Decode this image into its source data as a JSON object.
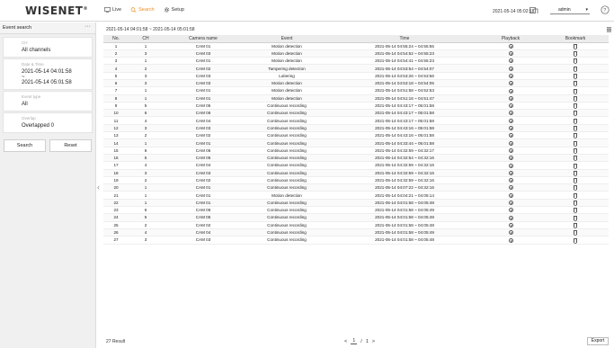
{
  "app": {
    "logo": "WISENET",
    "logo_mark": "®",
    "nav": [
      {
        "label": "Live"
      },
      {
        "label": "Search"
      },
      {
        "label": "Setup"
      }
    ],
    "datetime": "2021-05-14 05:02:18",
    "user": "admin"
  },
  "sidebar": {
    "title": "Event search",
    "more": "···",
    "channel": {
      "label": "CH",
      "value": "All channels"
    },
    "datetime": {
      "label": "Date & Time",
      "value_line1": "2021-05-14 04:01:58 ~",
      "value_line2": "2021-05-14 05:01:58"
    },
    "event_type": {
      "label": "Event type",
      "value": "All"
    },
    "overlap": {
      "label": "Overlap",
      "value": "Overlapped 0"
    },
    "search_button": "Search",
    "reset_button": "Reset"
  },
  "main": {
    "range": "2021-05-14 04:01:58 ~ 2021-05-14 05:01:58",
    "columns": [
      "No.",
      "CH",
      "Camera name",
      "Event",
      "Time",
      "Playback",
      "Bookmark"
    ],
    "rows": [
      [
        "1",
        "1",
        "CAM 01",
        "Motion detection",
        "2021-05-14 04:55:24 ~ 04:55:55"
      ],
      [
        "2",
        "3",
        "CAM 03",
        "Motion detection",
        "2021-05-14 04:54:52 ~ 04:55:23"
      ],
      [
        "3",
        "1",
        "CAM 01",
        "Motion detection",
        "2021-05-14 04:54:41 ~ 04:55:23"
      ],
      [
        "4",
        "2",
        "CAM 02",
        "Tampering detection",
        "2021-05-14 04:53:54 ~ 04:54:07"
      ],
      [
        "5",
        "3",
        "CAM 03",
        "Loitering",
        "2021-05-14 04:53:26 ~ 04:53:56"
      ],
      [
        "6",
        "3",
        "CAM 03",
        "Motion detection",
        "2021-05-14 04:53:18 ~ 04:54:05"
      ],
      [
        "7",
        "1",
        "CAM 01",
        "Motion detection",
        "2021-05-14 04:51:58 ~ 04:52:53"
      ],
      [
        "8",
        "1",
        "CAM 01",
        "Motion detection",
        "2021-05-14 04:51:16 ~ 04:51:47"
      ],
      [
        "9",
        "5",
        "CAM 05",
        "Continuous recording",
        "2021-05-14 04:43:17 ~ 05:01:58"
      ],
      [
        "10",
        "6",
        "CAM 06",
        "Continuous recording",
        "2021-05-14 04:43:17 ~ 05:01:58"
      ],
      [
        "11",
        "4",
        "CAM 04",
        "Continuous recording",
        "2021-05-14 04:43:17 ~ 05:01:58"
      ],
      [
        "12",
        "3",
        "CAM 03",
        "Continuous recording",
        "2021-05-14 04:43:16 ~ 05:01:58"
      ],
      [
        "13",
        "2",
        "CAM 02",
        "Continuous recording",
        "2021-05-14 04:43:16 ~ 05:01:58"
      ],
      [
        "14",
        "1",
        "CAM 01",
        "Continuous recording",
        "2021-05-14 04:33:44 ~ 05:01:58"
      ],
      [
        "15",
        "6",
        "CAM 06",
        "Continuous recording",
        "2021-05-14 04:32:59 ~ 04:32:17"
      ],
      [
        "16",
        "5",
        "CAM 05",
        "Continuous recording",
        "2021-05-14 04:32:54 ~ 04:32:16"
      ],
      [
        "17",
        "4",
        "CAM 04",
        "Continuous recording",
        "2021-05-14 04:32:59 ~ 04:32:16"
      ],
      [
        "18",
        "3",
        "CAM 03",
        "Continuous recording",
        "2021-05-14 04:32:59 ~ 04:32:16"
      ],
      [
        "19",
        "2",
        "CAM 02",
        "Continuous recording",
        "2021-05-14 04:32:59 ~ 04:32:16"
      ],
      [
        "20",
        "1",
        "CAM 01",
        "Continuous recording",
        "2021-05-14 04:07:22 ~ 04:32:16"
      ],
      [
        "21",
        "1",
        "CAM 01",
        "Motion detection",
        "2021-05-14 04:04:21 ~ 04:05:14"
      ],
      [
        "22",
        "1",
        "CAM 01",
        "Continuous recording",
        "2021-05-14 04:01:58 ~ 04:05:48"
      ],
      [
        "23",
        "6",
        "CAM 06",
        "Continuous recording",
        "2021-05-14 04:01:58 ~ 04:05:49"
      ],
      [
        "24",
        "5",
        "CAM 05",
        "Continuous recording",
        "2021-05-14 04:01:58 ~ 04:05:49"
      ],
      [
        "25",
        "2",
        "CAM 02",
        "Continuous recording",
        "2021-05-14 04:01:58 ~ 04:05:48"
      ],
      [
        "26",
        "4",
        "CAM 04",
        "Continuous recording",
        "2021-05-14 04:01:58 ~ 04:05:49"
      ],
      [
        "27",
        "3",
        "CAM 03",
        "Continuous recording",
        "2021-05-14 04:01:58 ~ 04:05:48"
      ]
    ],
    "result": "27 Result",
    "pager": {
      "prev": "<",
      "current": "1",
      "sep": "/",
      "total": "1",
      "next": ">"
    },
    "export_button": "Export"
  },
  "colors": {
    "accent": "#f08c1c"
  }
}
